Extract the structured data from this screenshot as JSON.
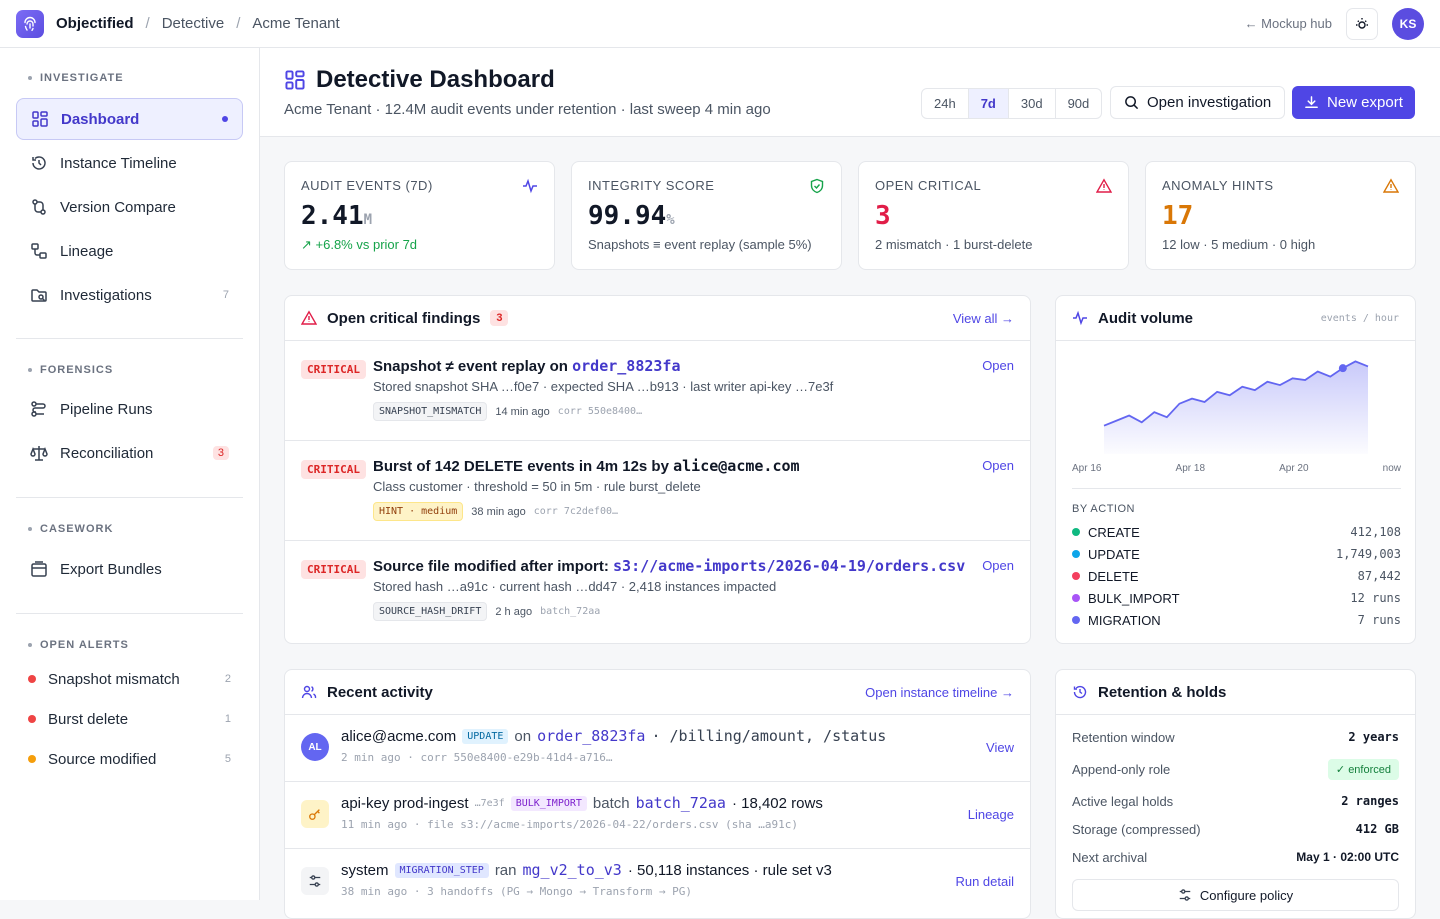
{
  "topbar": {
    "brand": "Objectified",
    "crumbs": [
      "Detective",
      "Acme Tenant"
    ],
    "hub_link": "← Mockup hub",
    "avatar_initials": "KS"
  },
  "sidebar": {
    "investigate_title": "INVESTIGATE",
    "investigate": [
      {
        "label": "Dashboard",
        "icon": "grid-icon"
      },
      {
        "label": "Instance Timeline",
        "icon": "history-icon"
      },
      {
        "label": "Version Compare",
        "icon": "compare-icon"
      },
      {
        "label": "Lineage",
        "icon": "lineage-icon"
      },
      {
        "label": "Investigations",
        "icon": "folder-search-icon",
        "count": "7"
      }
    ],
    "forensics_title": "FORENSICS",
    "forensics": [
      {
        "label": "Pipeline Runs",
        "icon": "pipeline-icon"
      },
      {
        "label": "Reconciliation",
        "icon": "scale-icon",
        "count": "3"
      }
    ],
    "casework_title": "CASEWORK",
    "casework": [
      {
        "label": "Export Bundles",
        "icon": "archive-icon"
      }
    ],
    "alerts_title": "OPEN ALERTS",
    "alerts": [
      {
        "label": "Snapshot mismatch",
        "count": "2",
        "color": "#ef4444"
      },
      {
        "label": "Burst delete",
        "count": "1",
        "color": "#ef4444"
      },
      {
        "label": "Source modified",
        "count": "5",
        "color": "#f59e0b"
      }
    ]
  },
  "header": {
    "title": "Detective Dashboard",
    "subtitle": "Acme Tenant · 12.4M audit events under retention · last sweep 4 min ago",
    "ranges": [
      "24h",
      "7d",
      "30d",
      "90d"
    ],
    "selected_range": "7d",
    "open_investigation": "Open investigation",
    "new_export": "New export"
  },
  "stats": [
    {
      "label": "AUDIT EVENTS (7D)",
      "value": "2.41",
      "unit": "M",
      "sub": "+6.8% vs prior 7d",
      "value_color": "#111827",
      "sub_color": "#16a34a"
    },
    {
      "label": "INTEGRITY SCORE",
      "value": "99.94",
      "unit": "%",
      "sub": "Snapshots ≡ event replay (sample 5%)",
      "value_color": "#111827",
      "sub_color": "#4b5563"
    },
    {
      "label": "OPEN CRITICAL",
      "value": "3",
      "unit": "",
      "sub": "2 mismatch · 1 burst-delete",
      "value_color": "#e11d48",
      "sub_color": "#4b5563"
    },
    {
      "label": "ANOMALY HINTS",
      "value": "17",
      "unit": "",
      "sub": "12 low · 5 medium · 0 high",
      "value_color": "#d97706",
      "sub_color": "#4b5563"
    }
  ],
  "findings": {
    "title": "Open critical findings",
    "count": "3",
    "view_all": "View all →",
    "items": [
      {
        "badge": "CRITICAL",
        "title_prefix": "Snapshot ≠ event replay on ",
        "title_code": "order_8823fa",
        "meta": "Stored snapshot SHA …f0e7 · expected SHA …b913 · last writer api-key  …7e3f",
        "tag": "SNAPSHOT_MISMATCH",
        "time": "14 min ago",
        "corr": "corr 550e8400…",
        "action": "Open"
      },
      {
        "badge": "CRITICAL",
        "title_prefix": "Burst of 142 DELETE events in 4m 12s by ",
        "title_code": "alice@acme.com",
        "meta": "Class customer · threshold = 50 in 5m · rule burst_delete",
        "tag": "HINT · medium",
        "time": "38 min ago",
        "corr": "corr 7c2def00…",
        "action": "Open"
      },
      {
        "badge": "CRITICAL",
        "title_prefix": "Source file modified after import: ",
        "title_code": "s3://acme-imports/2026-04-19/orders.csv",
        "meta": "Stored hash …a91c · current hash …dd47 · 2,418 instances impacted",
        "tag": "SOURCE_HASH_DRIFT",
        "time": "2 h ago",
        "corr": "batch_72aa",
        "action": "Open"
      }
    ]
  },
  "audit_volume": {
    "title": "Audit volume",
    "unit_label": "events / hour",
    "x_labels": [
      "Apr 16",
      "Apr 18",
      "Apr 20",
      "now"
    ],
    "by_action_title": "BY ACTION",
    "actions": [
      {
        "name": "CREATE",
        "value": "412,108",
        "color": "#10b981"
      },
      {
        "name": "UPDATE",
        "value": "1,749,003",
        "color": "#0ea5e9"
      },
      {
        "name": "DELETE",
        "value": "87,442",
        "color": "#f43f5e"
      },
      {
        "name": "BULK_IMPORT",
        "value": "12 runs",
        "color": "#a855f7"
      },
      {
        "name": "MIGRATION",
        "value": "7 runs",
        "color": "#6366f1"
      }
    ]
  },
  "chart_data": {
    "type": "area",
    "title": "Audit volume",
    "xlabel": "",
    "ylabel": "events / hour",
    "x_tick_labels": [
      "Apr 16",
      "Apr 18",
      "Apr 20",
      "now"
    ],
    "series": [
      {
        "values": [
          12,
          15,
          18,
          14,
          20,
          17,
          25,
          28,
          26,
          32,
          30,
          35,
          33,
          38,
          36,
          40,
          39,
          44,
          41,
          46,
          50,
          47
        ]
      }
    ],
    "grid": false
  },
  "activity": {
    "title": "Recent activity",
    "link": "Open instance timeline →",
    "items": [
      {
        "avatar": "AL",
        "actor": "alice@acme.com",
        "pill": "UPDATE",
        "text1": "on",
        "link1": "order_8823fa",
        "text2": "· /billing/amount, /status",
        "sub": "2 min ago · corr 550e8400-e29b-41d4-a716…",
        "action": "View"
      },
      {
        "avatar": "",
        "actor": "api-key prod-ingest",
        "actor_suffix": "…7e3f",
        "pill": "BULK_IMPORT",
        "text1": "batch",
        "link1": "batch_72aa",
        "text2": "· 18,402 rows",
        "sub": "11 min ago · file s3://acme-imports/2026-04-22/orders.csv (sha …a91c)",
        "action": "Lineage"
      },
      {
        "avatar": "",
        "actor": "system",
        "pill": "MIGRATION_STEP",
        "text1": "ran",
        "link1": "mg_v2_to_v3",
        "text2": "· 50,118 instances · rule set v3",
        "sub": "38 min ago · 3 handoffs (PG → Mongo → Transform → PG)",
        "action": "Run detail"
      }
    ]
  },
  "retention": {
    "title": "Retention & holds",
    "rows": [
      {
        "label": "Retention window",
        "value": "2 years"
      },
      {
        "label": "Append-only role",
        "value": "enforced"
      },
      {
        "label": "Active legal holds",
        "value": "2 ranges"
      },
      {
        "label": "Storage (compressed)",
        "value": "412 GB"
      },
      {
        "label": "Next archival",
        "value": "May 1 · 02:00 UTC"
      }
    ],
    "configure": "Configure policy"
  }
}
